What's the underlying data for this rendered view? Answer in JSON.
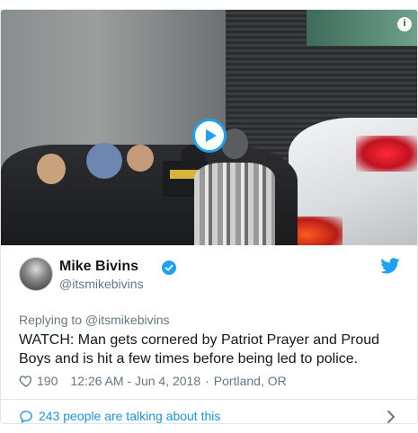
{
  "media": {
    "type": "video",
    "play_icon": "play-icon",
    "info_icon": "info-icon",
    "info_glyph": "i"
  },
  "author": {
    "name": "Mike Bivins",
    "handle": "@itsmikebivins",
    "verified": true,
    "avatar_icon": "avatar"
  },
  "tweet": {
    "reply_to": "Replying to @itsmikebivins",
    "text": "WATCH: Man gets cornered by Patriot Prayer and Proud Boys and is hit a few times before being led to police.",
    "likes": "190",
    "timestamp": "12:26 AM - Jun 4, 2018",
    "separator": "·",
    "location": "Portland, OR"
  },
  "footer": {
    "talking": "243 people are talking about this"
  },
  "colors": {
    "accent": "#1da1f2",
    "link": "#1b95e0",
    "muted": "#657786",
    "text": "#14171a",
    "border": "#e1e8ed"
  }
}
